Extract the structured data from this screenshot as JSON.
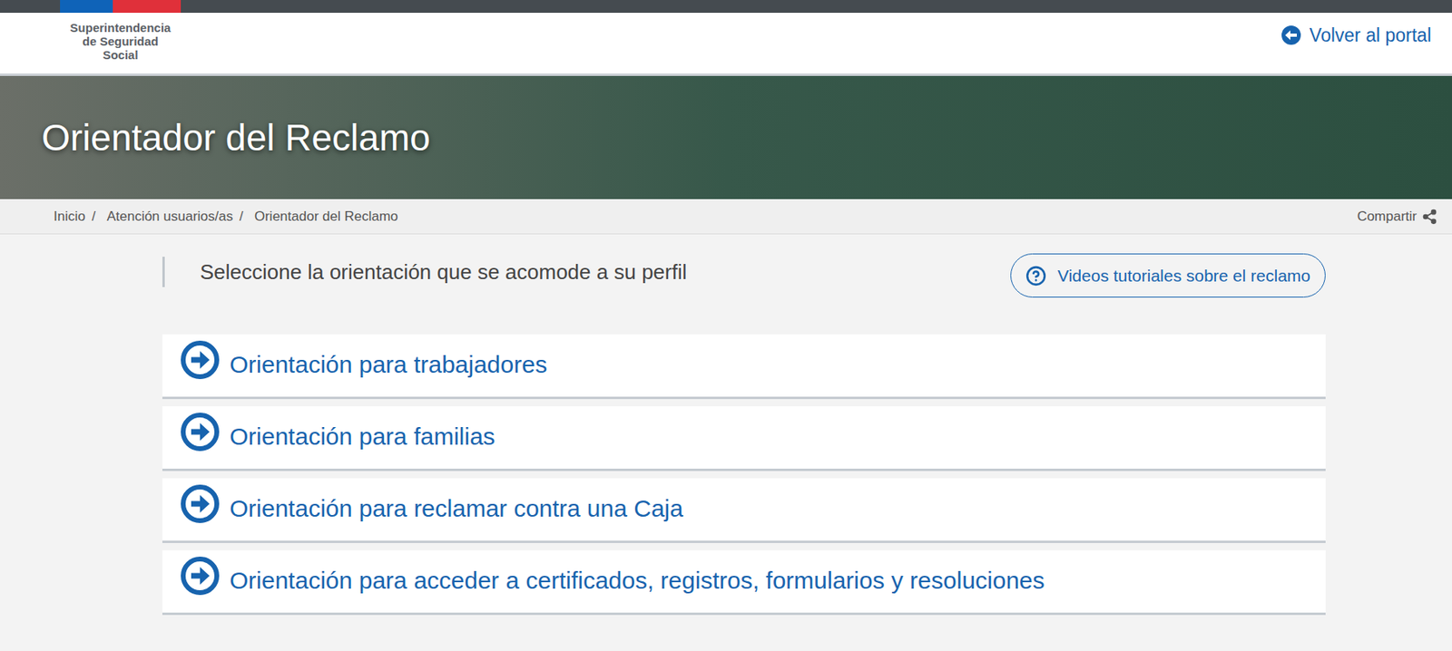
{
  "header": {
    "logo": [
      "Superintendencia",
      "de Seguridad",
      "Social"
    ],
    "back_link": "Volver al portal"
  },
  "banner": {
    "title": "Orientador del Reclamo"
  },
  "breadcrumb": {
    "items": [
      "Inicio",
      "Atención usuarios/as",
      "Orientador del Reclamo"
    ],
    "separator": "/",
    "share": "Compartir"
  },
  "intro": "Seleccione la orientación que se acomode a su perfil",
  "tutorial_button": "Videos tutoriales sobre el reclamo",
  "options": [
    {
      "label": "Orientación para trabajadores"
    },
    {
      "label": "Orientación para familias"
    },
    {
      "label": "Orientación para reclamar contra una Caja"
    },
    {
      "label": "Orientación para acceder a certificados, registros, formularios y resoluciones"
    }
  ]
}
